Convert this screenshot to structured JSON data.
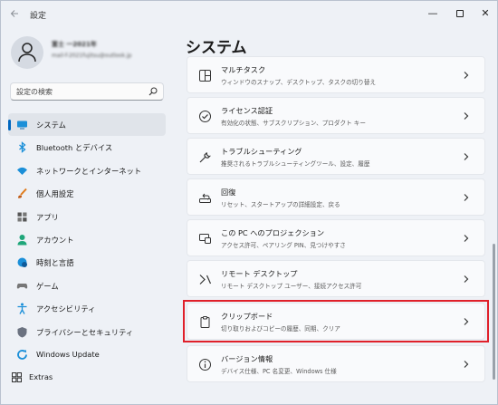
{
  "window": {
    "title": "設定",
    "back_icon": "back-arrow-icon",
    "controls": {
      "minimize": "—",
      "close": "✕"
    }
  },
  "profile": {
    "name": "富士 一2021年",
    "email": "mail-f-2021fujitsu@outlook.jp"
  },
  "search": {
    "placeholder": "設定の検索"
  },
  "sidebar": {
    "items": [
      {
        "label": "システム",
        "icon": "monitor-icon",
        "selected": true
      },
      {
        "label": "Bluetooth とデバイス",
        "icon": "bluetooth-icon"
      },
      {
        "label": "ネットワークとインターネット",
        "icon": "wifi-icon"
      },
      {
        "label": "個人用設定",
        "icon": "brush-icon"
      },
      {
        "label": "アプリ",
        "icon": "apps-icon"
      },
      {
        "label": "アカウント",
        "icon": "person-icon"
      },
      {
        "label": "時刻と言語",
        "icon": "globe-clock-icon"
      },
      {
        "label": "ゲーム",
        "icon": "gamepad-icon"
      },
      {
        "label": "アクセシビリティ",
        "icon": "accessibility-icon"
      },
      {
        "label": "プライバシーとセキュリティ",
        "icon": "shield-icon"
      },
      {
        "label": "Windows Update",
        "icon": "update-icon"
      },
      {
        "label": "Extras",
        "icon": "extras-grid-icon"
      }
    ]
  },
  "main": {
    "title": "システム",
    "cards": [
      {
        "title": "マルチタスク",
        "desc": "ウィンドウのスナップ、デスクトップ、タスクの切り替え",
        "icon": "multitask-icon"
      },
      {
        "title": "ライセンス認証",
        "desc": "有効化の状態、サブスクリプション、プロダクト キー",
        "icon": "check-circle-icon"
      },
      {
        "title": "トラブルシューティング",
        "desc": "推奨されるトラブルシューティングツール、設定、履歴",
        "icon": "wrench-icon"
      },
      {
        "title": "回復",
        "desc": "リセット、スタートアップの詳細設定、戻る",
        "icon": "recovery-icon"
      },
      {
        "title": "この PC へのプロジェクション",
        "desc": "アクセス許可、ペアリング PIN、見つけやすさ",
        "icon": "projection-icon"
      },
      {
        "title": "リモート デスクトップ",
        "desc": "リモート デスクトップ ユーザー、接続アクセス許可",
        "icon": "remote-desktop-icon"
      },
      {
        "title": "クリップボード",
        "desc": "切り取りおよびコピーの履歴、同期、クリア",
        "icon": "clipboard-icon",
        "highlighted": true
      },
      {
        "title": "バージョン情報",
        "desc": "デバイス仕様、PC 名変更、Windows 仕様",
        "icon": "info-icon"
      }
    ]
  },
  "colors": {
    "accent": "#0067c0",
    "highlight_border": "#e0202a",
    "background": "#eef1f6",
    "card": "#f9fafc"
  }
}
